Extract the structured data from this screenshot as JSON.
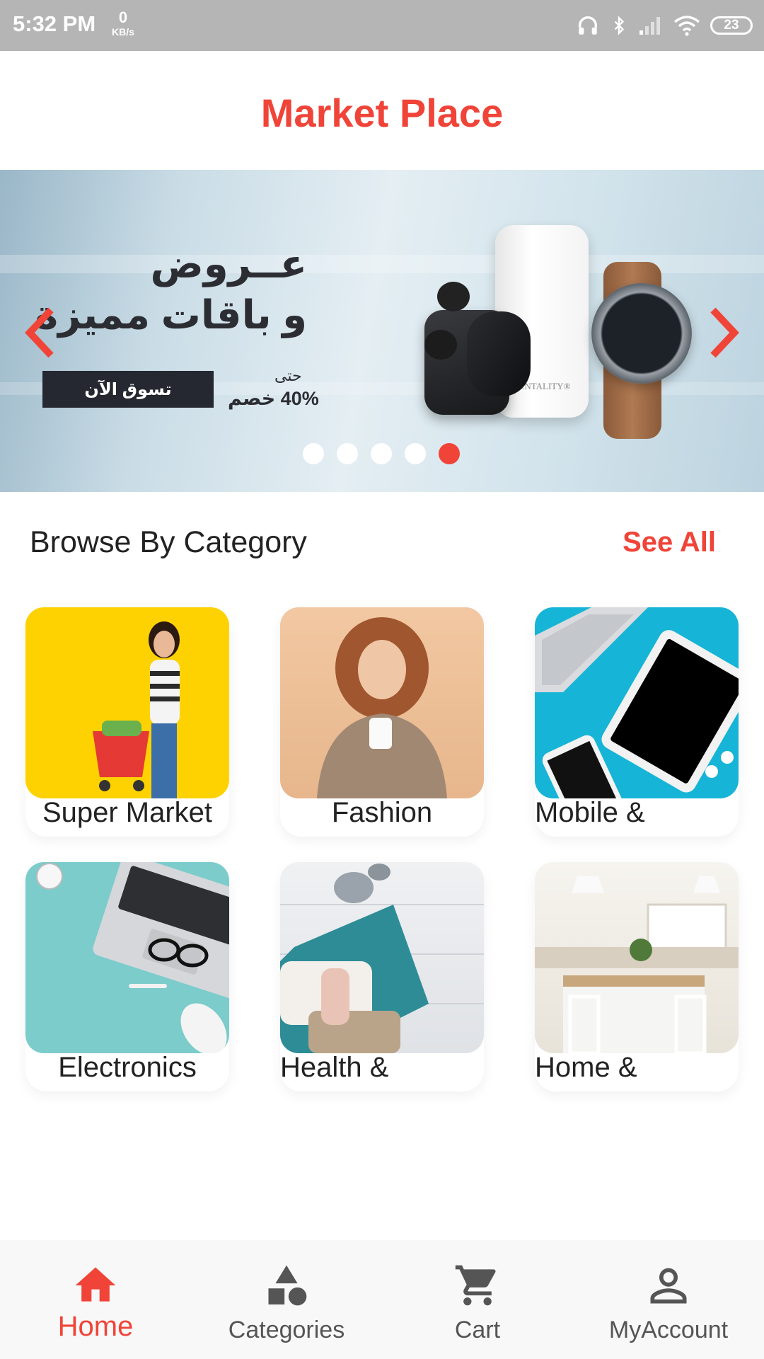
{
  "status_bar": {
    "time": "5:32 PM",
    "net_speed_value": "0",
    "net_speed_unit": "KB/s",
    "battery": "23",
    "icons": [
      "headphones-icon",
      "bluetooth-icon",
      "signal-icon",
      "wifi-icon",
      "battery-icon"
    ]
  },
  "app_bar": {
    "title": "Market Place"
  },
  "banner": {
    "title_line1": "عــروض",
    "title_line2": "و باقات مميزة",
    "shop_button": "تسوق الآن",
    "upto": "حتى",
    "discount": "40% خصم",
    "product_brand": "ZENTALITY®",
    "slide_count": 5,
    "active_slide": 5
  },
  "colors": {
    "accent": "#f04438",
    "dark": "#252831"
  },
  "categories_section": {
    "title": "Browse By Category",
    "see_all": "See All",
    "items": [
      {
        "label": "Super Market"
      },
      {
        "label": "Fashion"
      },
      {
        "label": "Mobile &"
      },
      {
        "label": "Electronics"
      },
      {
        "label": "Health &"
      },
      {
        "label": "Home &"
      }
    ]
  },
  "bottom_nav": {
    "active": "Home",
    "items": [
      {
        "label": "Home",
        "icon": "home-icon"
      },
      {
        "label": "Categories",
        "icon": "categories-icon"
      },
      {
        "label": "Cart",
        "icon": "cart-icon"
      },
      {
        "label": "MyAccount",
        "icon": "account-icon"
      }
    ]
  }
}
